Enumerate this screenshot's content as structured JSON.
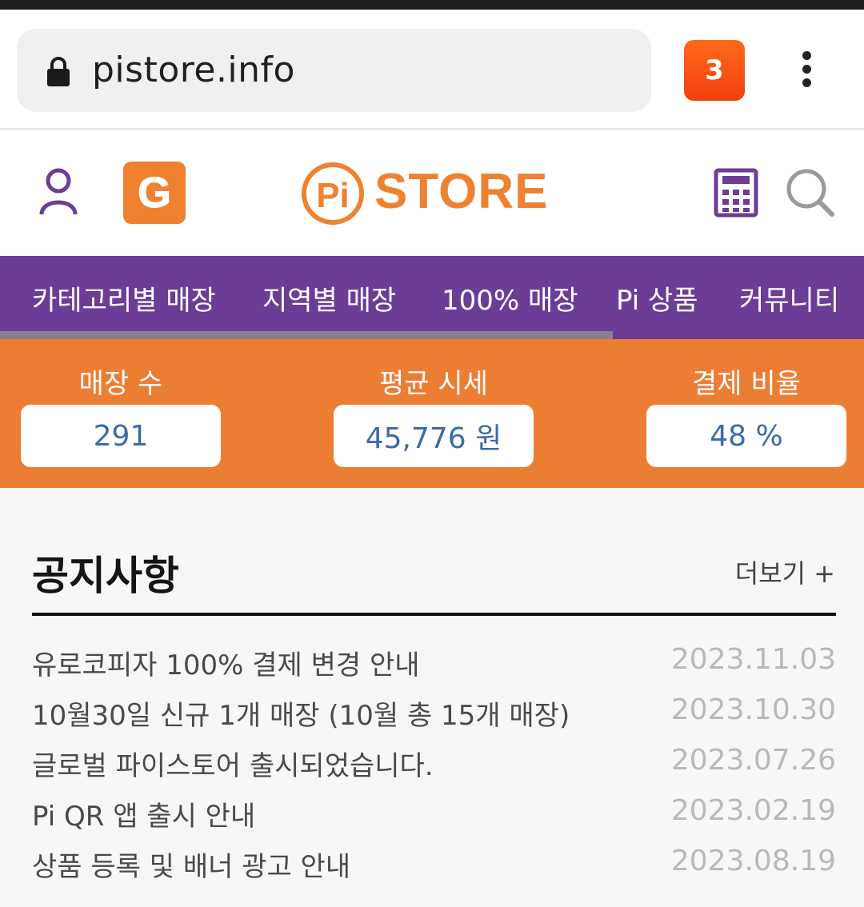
{
  "browser": {
    "url": "pistore.info",
    "tab_count": "3"
  },
  "header": {
    "g_badge": "G",
    "logo_pi": "Pi",
    "logo_text": "STORE",
    "icons": [
      "user-icon",
      "calculator-icon",
      "search-icon"
    ]
  },
  "nav": {
    "items": [
      {
        "label": "카테고리별 매장"
      },
      {
        "label": "지역별 매장"
      },
      {
        "label": "100% 매장"
      },
      {
        "label": "Pi 상품"
      },
      {
        "label": "커뮤니티"
      }
    ]
  },
  "stats": [
    {
      "label": "매장 수",
      "value": "291"
    },
    {
      "label": "평균 시세",
      "value": "45,776 원"
    },
    {
      "label": "결제 비율",
      "value": "48 %"
    }
  ],
  "notices": {
    "title": "공지사항",
    "more": "더보기 +",
    "items": [
      {
        "title": "유로코피자 100% 결제 변경 안내",
        "date": "2023.11.03"
      },
      {
        "title": "10월30일 신규 1개 매장 (10월 총 15개 매장)",
        "date": "2023.10.30"
      },
      {
        "title": "글로벌 파이스토어 출시되었습니다.",
        "date": "2023.07.26"
      },
      {
        "title": "Pi QR 앱 출시 안내",
        "date": "2023.02.19"
      },
      {
        "title": "상품 등록 및 배너 광고 안내",
        "date": "2023.08.19"
      }
    ]
  },
  "colors": {
    "brand_orange": "#ec7e34",
    "nav_purple": "#6b3d96",
    "stat_value_blue": "#3d6aa8"
  }
}
